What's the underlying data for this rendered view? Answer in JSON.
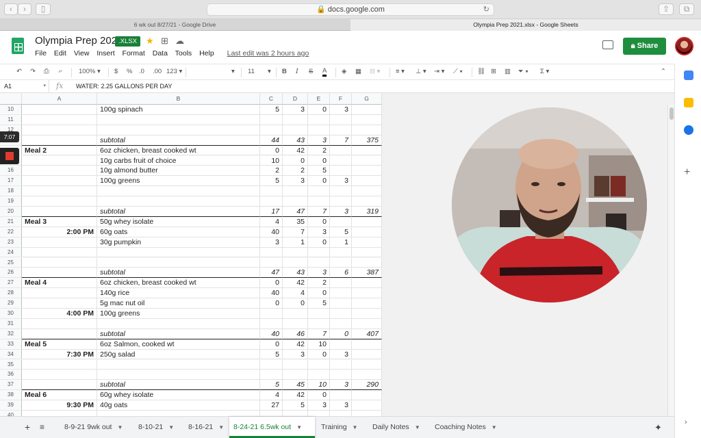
{
  "browser": {
    "url": "docs.google.com",
    "tabs": [
      "6 wk out 8/27/21 - Google Drive",
      "Olympia Prep 2021.xlsx - Google Sheets"
    ]
  },
  "doc": {
    "title": "Olympia Prep 2021",
    "badge": ".XLSX",
    "menus": [
      "File",
      "Edit",
      "View",
      "Insert",
      "Format",
      "Data",
      "Tools",
      "Help"
    ],
    "last_edit": "Last edit was 2 hours ago",
    "share_label": "Share"
  },
  "toolbar": {
    "zoom": "100%",
    "currency": "$",
    "percent": "%",
    "dec_less": ".0",
    "dec_more": ".00",
    "format_more": "123",
    "font_size": "11"
  },
  "formula": {
    "cell_ref": "A1",
    "fx": "fx",
    "content": "WATER: 2.25 GALLONS PER DAY"
  },
  "columns": [
    "A",
    "B",
    "C",
    "D",
    "E",
    "F",
    "G"
  ],
  "rows": [
    {
      "n": "10",
      "a": "",
      "b": "100g spinach",
      "c": "5",
      "d": "3",
      "e": "0",
      "f": "3",
      "g": ""
    },
    {
      "n": "11",
      "a": "",
      "b": "",
      "c": "",
      "d": "",
      "e": "",
      "f": "",
      "g": ""
    },
    {
      "n": "12",
      "a": "",
      "b": "",
      "c": "",
      "d": "",
      "e": "",
      "f": "",
      "g": ""
    },
    {
      "n": "13",
      "a": "",
      "b": "subtotal",
      "c": "44",
      "d": "43",
      "e": "3",
      "f": "7",
      "g": "375",
      "sub": true
    },
    {
      "n": "14",
      "a": "Meal 2",
      "b": "6oz chicken, breast cooked wt",
      "c": "0",
      "d": "42",
      "e": "2",
      "f": "",
      "g": "",
      "meal": true
    },
    {
      "n": "15",
      "a": "",
      "b": "10g carbs fruit of choice",
      "c": "10",
      "d": "0",
      "e": "0",
      "f": "",
      "g": ""
    },
    {
      "n": "16",
      "a": "",
      "b": "10g almond butter",
      "c": "2",
      "d": "2",
      "e": "5",
      "f": "",
      "g": ""
    },
    {
      "n": "17",
      "a": "",
      "b": "100g greens",
      "c": "5",
      "d": "3",
      "e": "0",
      "f": "3",
      "g": ""
    },
    {
      "n": "18",
      "a": "",
      "b": "",
      "c": "",
      "d": "",
      "e": "",
      "f": "",
      "g": ""
    },
    {
      "n": "19",
      "a": "",
      "b": "",
      "c": "",
      "d": "",
      "e": "",
      "f": "",
      "g": ""
    },
    {
      "n": "20",
      "a": "",
      "b": "subtotal",
      "c": "17",
      "d": "47",
      "e": "7",
      "f": "3",
      "g": "319",
      "sub": true
    },
    {
      "n": "21",
      "a": "Meal 3",
      "b": "50g whey isolate",
      "c": "4",
      "d": "35",
      "e": "0",
      "f": "",
      "g": "",
      "meal": true
    },
    {
      "n": "22",
      "a": "2:00 PM",
      "b": "60g oats",
      "c": "40",
      "d": "7",
      "e": "3",
      "f": "5",
      "g": "",
      "time": true
    },
    {
      "n": "23",
      "a": "",
      "b": "30g pumpkin",
      "c": "3",
      "d": "1",
      "e": "0",
      "f": "1",
      "g": ""
    },
    {
      "n": "24",
      "a": "",
      "b": "",
      "c": "",
      "d": "",
      "e": "",
      "f": "",
      "g": ""
    },
    {
      "n": "25",
      "a": "",
      "b": "",
      "c": "",
      "d": "",
      "e": "",
      "f": "",
      "g": ""
    },
    {
      "n": "26",
      "a": "",
      "b": "subtotal",
      "c": "47",
      "d": "43",
      "e": "3",
      "f": "6",
      "g": "387",
      "sub": true
    },
    {
      "n": "27",
      "a": "Meal 4",
      "b": "6oz chicken, breast cooked wt",
      "c": "0",
      "d": "42",
      "e": "2",
      "f": "",
      "g": "",
      "meal": true
    },
    {
      "n": "28",
      "a": "",
      "b": "140g rice",
      "c": "40",
      "d": "4",
      "e": "0",
      "f": "",
      "g": ""
    },
    {
      "n": "29",
      "a": "",
      "b": "5g mac nut oil",
      "c": "0",
      "d": "0",
      "e": "5",
      "f": "",
      "g": ""
    },
    {
      "n": "30",
      "a": "4:00 PM",
      "b": "100g greens",
      "c": "",
      "d": "",
      "e": "",
      "f": "",
      "g": "",
      "time": true
    },
    {
      "n": "31",
      "a": "",
      "b": "",
      "c": "",
      "d": "",
      "e": "",
      "f": "",
      "g": ""
    },
    {
      "n": "32",
      "a": "",
      "b": "subtotal",
      "c": "40",
      "d": "46",
      "e": "7",
      "f": "0",
      "g": "407",
      "sub": true
    },
    {
      "n": "33",
      "a": "Meal 5",
      "b": "6oz Salmon, cooked wt",
      "c": "0",
      "d": "42",
      "e": "10",
      "f": "",
      "g": "",
      "meal": true
    },
    {
      "n": "34",
      "a": "7:30 PM",
      "b": "250g salad",
      "c": "5",
      "d": "3",
      "e": "0",
      "f": "3",
      "g": "",
      "time": true
    },
    {
      "n": "35",
      "a": "",
      "b": "",
      "c": "",
      "d": "",
      "e": "",
      "f": "",
      "g": ""
    },
    {
      "n": "36",
      "a": "",
      "b": "",
      "c": "",
      "d": "",
      "e": "",
      "f": "",
      "g": ""
    },
    {
      "n": "37",
      "a": "",
      "b": "subtotal",
      "c": "5",
      "d": "45",
      "e": "10",
      "f": "3",
      "g": "290",
      "sub": true
    },
    {
      "n": "38",
      "a": "Meal 6",
      "b": "60g whey isolate",
      "c": "4",
      "d": "42",
      "e": "0",
      "f": "",
      "g": "",
      "meal": true
    },
    {
      "n": "39",
      "a": "9:30 PM",
      "b": "40g oats",
      "c": "27",
      "d": "5",
      "e": "3",
      "f": "3",
      "g": "",
      "time": true
    },
    {
      "n": "40",
      "a": "",
      "b": "",
      "c": "",
      "d": "",
      "e": "",
      "f": "",
      "g": ""
    }
  ],
  "recording": {
    "timer": "7:07"
  },
  "sheet_tabs": [
    {
      "label": "8-9-21 9wk out",
      "active": false
    },
    {
      "label": "8-10-21",
      "active": false
    },
    {
      "label": "8-16-21",
      "active": false
    },
    {
      "label": "8-24-21 6.5wk out",
      "active": true
    },
    {
      "label": "Training",
      "active": false
    },
    {
      "label": "Daily Notes",
      "active": false
    },
    {
      "label": "Coaching Notes",
      "active": false
    }
  ],
  "colors": {
    "brand_green": "#188038",
    "share_green": "#1e8e3e",
    "sheets_logo": "#23a566"
  }
}
